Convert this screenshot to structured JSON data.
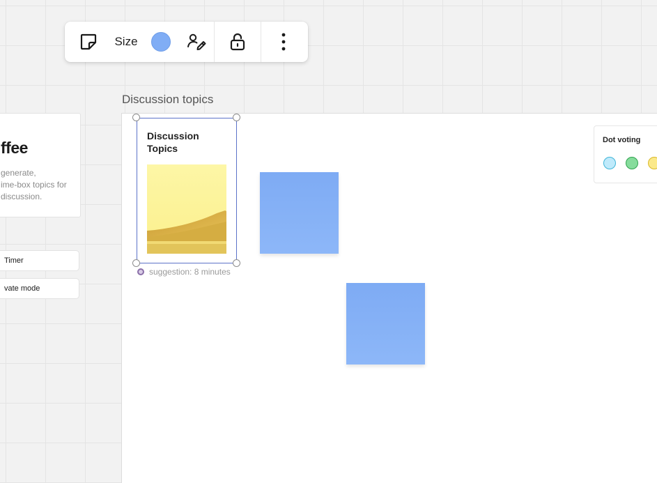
{
  "toolbar": {
    "size_label": "Size",
    "color": "#80adf5",
    "icons": [
      "sticky-note-icon",
      "pen-icon",
      "unlock-icon",
      "more-vertical-icon"
    ]
  },
  "left_card": {
    "title": "ffee",
    "description": "generate,\nime-box topics for\ndiscussion."
  },
  "left_buttons": {
    "timer": "Timer",
    "private_mode": "vate mode"
  },
  "frame": {
    "label": "Discussion topics"
  },
  "template_card": {
    "title": "Discussion Topics",
    "suggestion": "suggestion: 8 minutes"
  },
  "sticky_notes": [
    {
      "color": "#80adf5"
    },
    {
      "color": "#80adf5"
    }
  ],
  "dot_voting": {
    "title": "Dot voting",
    "dots": [
      {
        "fill": "#bfeafb",
        "border": "#3fb5d8"
      },
      {
        "fill": "#86dc9c",
        "border": "#2fa34e"
      },
      {
        "fill": "#fbe98a",
        "border": "#d9b829"
      }
    ]
  }
}
